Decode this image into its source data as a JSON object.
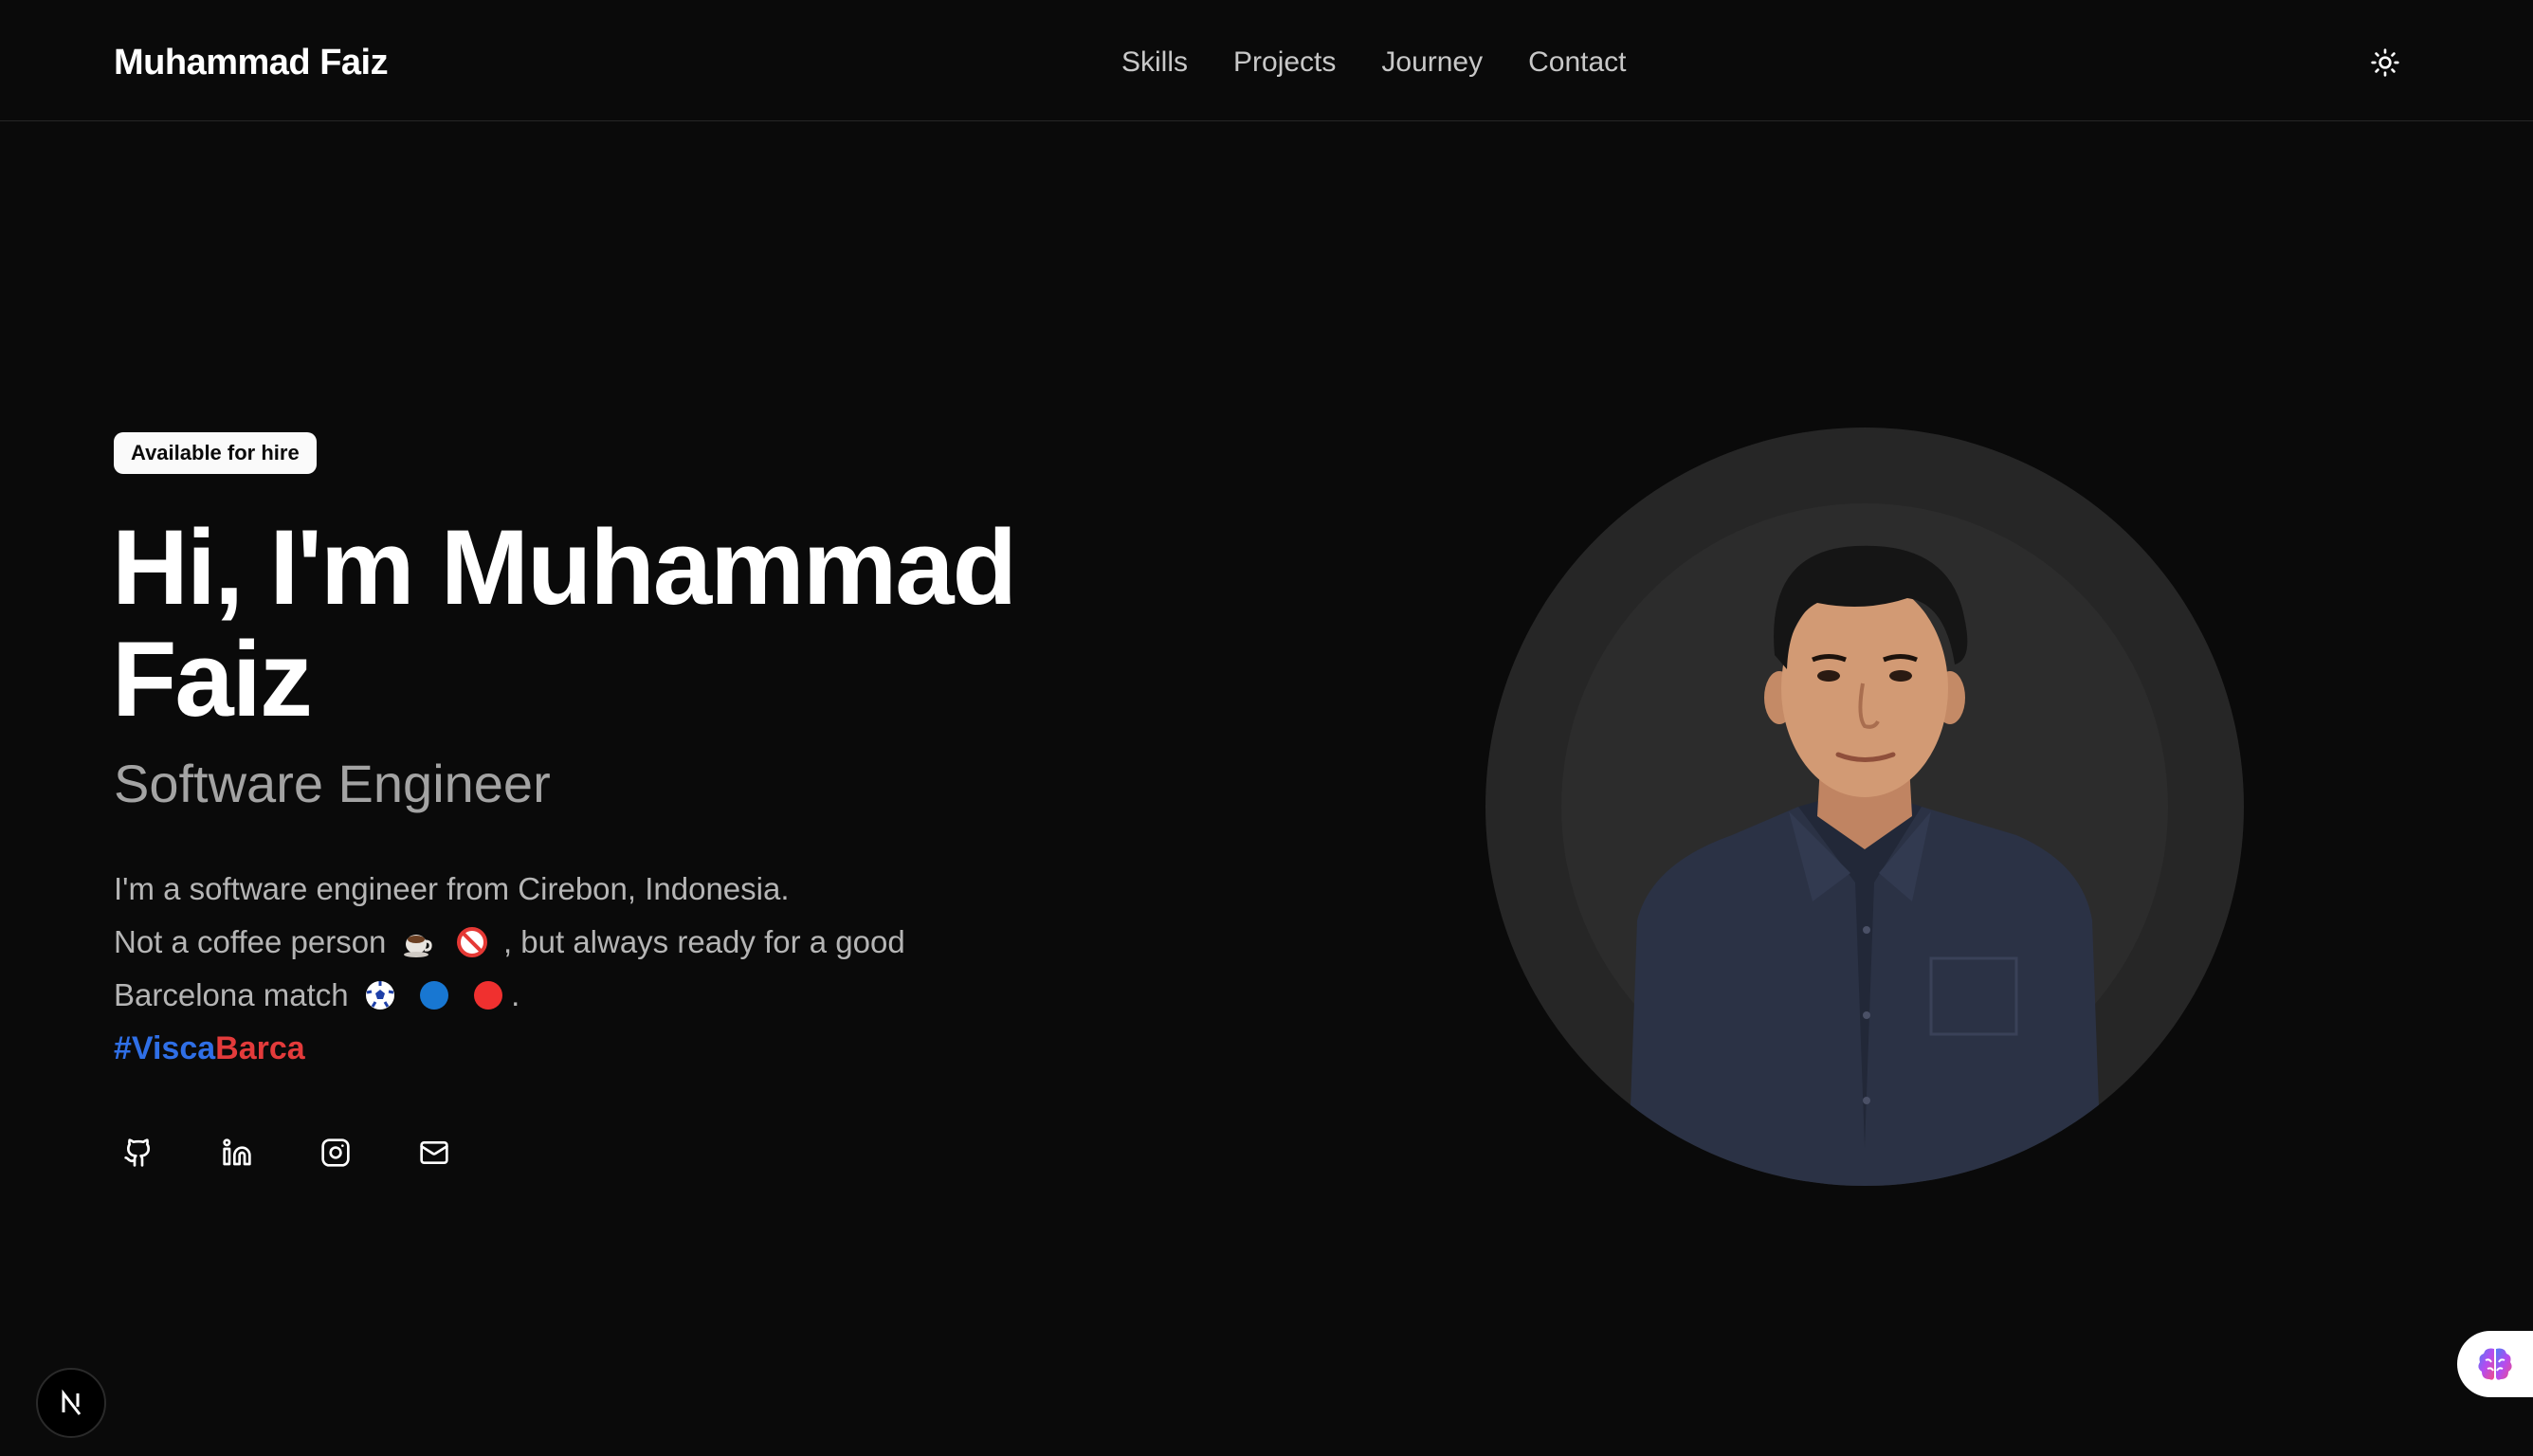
{
  "header": {
    "brand": "Muhammad Faiz",
    "nav": [
      {
        "label": "Skills"
      },
      {
        "label": "Projects"
      },
      {
        "label": "Journey"
      },
      {
        "label": "Contact"
      }
    ],
    "theme_toggle_icon": "sun-icon"
  },
  "hero": {
    "badge": "Available for hire",
    "title_line1": "Hi, I'm Muhammad",
    "title_line2": "Faiz",
    "subtitle": "Software Engineer",
    "bio": {
      "line1": "I'm a software engineer from Cirebon, Indonesia.",
      "line2_a": "Not a coffee person",
      "line2_b": ", but always ready for a good",
      "line3_a": "Barcelona match",
      "line3_b": ".",
      "hashtag_a": "#Visca",
      "hashtag_b": "Barca"
    },
    "emojis": [
      "coffee-icon",
      "prohibited-icon",
      "soccer-ball-icon",
      "blue-circle-icon",
      "red-circle-icon"
    ],
    "socials": [
      {
        "icon": "github-icon"
      },
      {
        "icon": "linkedin-icon"
      },
      {
        "icon": "instagram-icon"
      },
      {
        "icon": "mail-icon"
      }
    ]
  },
  "colors": {
    "background": "#0a0a0a",
    "hashtag_blue": "#2f6fe6",
    "hashtag_red": "#e33b3b"
  }
}
